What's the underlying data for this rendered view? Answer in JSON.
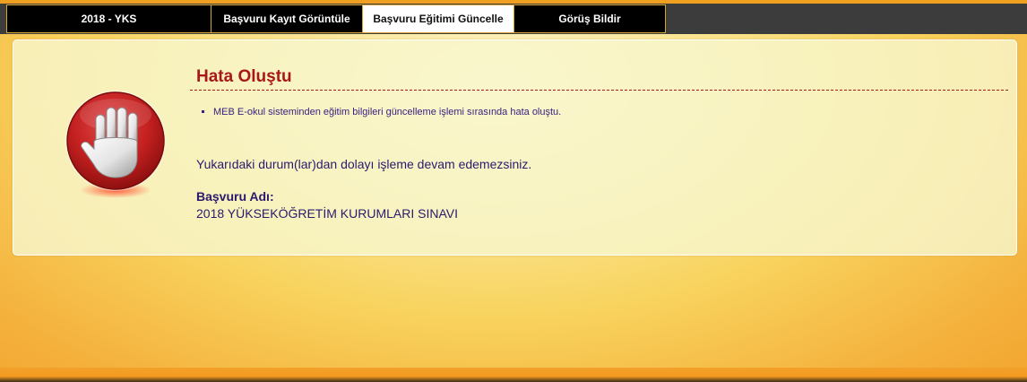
{
  "tabs": [
    {
      "label": "2018 - YKS",
      "active": false
    },
    {
      "label": "Başvuru Kayıt Görüntüle",
      "active": false
    },
    {
      "label": "Başvuru Eğitimi Güncelle",
      "active": true
    },
    {
      "label": "Görüş Bildir",
      "active": false
    }
  ],
  "error": {
    "title": "Hata Oluştu",
    "items": [
      "MEB E-okul sisteminden eğitim bilgileri güncelleme işlemi sırasında hata oluştu."
    ],
    "message": "Yukarıdaki durum(lar)dan dolayı işleme devam edemezsiniz.",
    "application_label": "Başvuru Adı:",
    "application_name": "2018 YÜKSEKÖĞRETİM KURUMLARI SINAVI",
    "icon": "stop-hand-icon"
  },
  "colors": {
    "accent": "#f0a020",
    "title": "#a81818",
    "text": "#2a1a6e",
    "tab_bg": "#000000",
    "tab_active_bg": "#ffffff"
  }
}
